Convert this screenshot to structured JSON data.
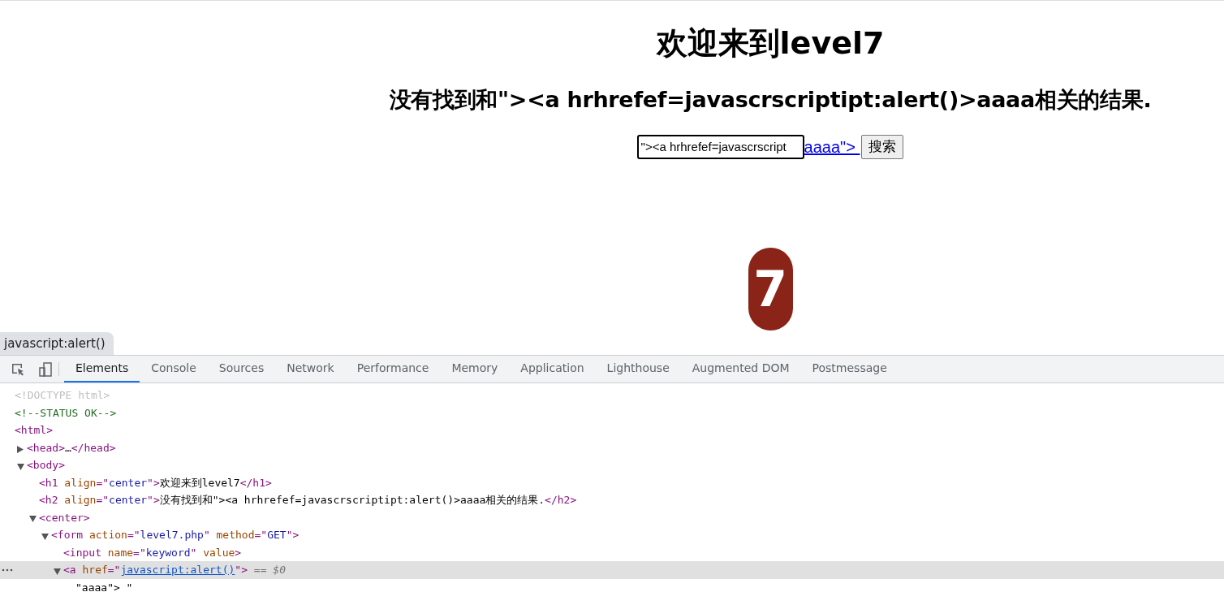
{
  "page": {
    "heading": "欢迎来到level7",
    "result": "没有找到和\"><a hrhrefef=javascrscriptipt:alert()>aaaa相关的结果.",
    "search": {
      "value": "\"><a hrhrefef=javascrscript",
      "focused": true
    },
    "link_text": "aaaa\">",
    "button": "搜索",
    "logo_text": "7"
  },
  "status_tooltip": "javascript:alert()",
  "devtools": {
    "tabs": [
      {
        "label": "Elements",
        "selected": true
      },
      {
        "label": "Console",
        "selected": false
      },
      {
        "label": "Sources",
        "selected": false
      },
      {
        "label": "Network",
        "selected": false
      },
      {
        "label": "Performance",
        "selected": false
      },
      {
        "label": "Memory",
        "selected": false
      },
      {
        "label": "Application",
        "selected": false
      },
      {
        "label": "Lighthouse",
        "selected": false
      },
      {
        "label": "Augmented DOM",
        "selected": false
      },
      {
        "label": "Postmessage",
        "selected": false
      }
    ],
    "tree": [
      {
        "tokens": [
          {
            "kind": "doctype",
            "text": "<!DOCTYPE html>"
          }
        ]
      },
      {
        "tokens": [
          {
            "kind": "comment",
            "text": "<!--STATUS OK-->"
          }
        ]
      },
      {
        "tokens": [
          {
            "kind": "tag",
            "text": "<html>"
          }
        ],
        "children": [
          {
            "expanded": false,
            "tokens": [
              {
                "kind": "tag",
                "text": "<head>"
              },
              {
                "kind": "text",
                "text": "…"
              },
              {
                "kind": "tag",
                "text": "</head>"
              }
            ]
          },
          {
            "expanded": true,
            "tokens": [
              {
                "kind": "tag",
                "text": "<body>"
              }
            ],
            "children": [
              {
                "tokens": [
                  {
                    "kind": "tag",
                    "text": "<h1 "
                  },
                  {
                    "kind": "attr",
                    "text": "align"
                  },
                  {
                    "kind": "tag",
                    "text": "=\""
                  },
                  {
                    "kind": "value",
                    "text": "center"
                  },
                  {
                    "kind": "tag",
                    "text": "\">"
                  },
                  {
                    "kind": "text",
                    "text": "欢迎来到level7"
                  },
                  {
                    "kind": "tag",
                    "text": "</h1>"
                  }
                ]
              },
              {
                "tokens": [
                  {
                    "kind": "tag",
                    "text": "<h2 "
                  },
                  {
                    "kind": "attr",
                    "text": "align"
                  },
                  {
                    "kind": "tag",
                    "text": "=\""
                  },
                  {
                    "kind": "value",
                    "text": "center"
                  },
                  {
                    "kind": "tag",
                    "text": "\">"
                  },
                  {
                    "kind": "text",
                    "text": "没有找到和\"><a hrhrefef=javascrscriptipt:alert()>aaaa相关的结果."
                  },
                  {
                    "kind": "tag",
                    "text": "</h2>"
                  }
                ]
              },
              {
                "expanded": true,
                "tokens": [
                  {
                    "kind": "tag",
                    "text": "<center>"
                  }
                ],
                "children": [
                  {
                    "expanded": true,
                    "tokens": [
                      {
                        "kind": "tag",
                        "text": "<form "
                      },
                      {
                        "kind": "attr",
                        "text": "action"
                      },
                      {
                        "kind": "tag",
                        "text": "=\""
                      },
                      {
                        "kind": "value",
                        "text": "level7.php"
                      },
                      {
                        "kind": "tag",
                        "text": "\" "
                      },
                      {
                        "kind": "attr",
                        "text": "method"
                      },
                      {
                        "kind": "tag",
                        "text": "=\""
                      },
                      {
                        "kind": "value",
                        "text": "GET"
                      },
                      {
                        "kind": "tag",
                        "text": "\">"
                      }
                    ],
                    "children": [
                      {
                        "tokens": [
                          {
                            "kind": "tag",
                            "text": "<input "
                          },
                          {
                            "kind": "attr",
                            "text": "name"
                          },
                          {
                            "kind": "tag",
                            "text": "=\""
                          },
                          {
                            "kind": "value",
                            "text": "keyword"
                          },
                          {
                            "kind": "tag",
                            "text": "\" "
                          },
                          {
                            "kind": "attr",
                            "text": "value"
                          },
                          {
                            "kind": "tag",
                            "text": ">"
                          }
                        ]
                      },
                      {
                        "expanded": true,
                        "selected": true,
                        "tokens": [
                          {
                            "kind": "tag",
                            "text": "<a "
                          },
                          {
                            "kind": "attr",
                            "text": "href"
                          },
                          {
                            "kind": "tag",
                            "text": "=\""
                          },
                          {
                            "kind": "link",
                            "text": "javascript:alert()"
                          },
                          {
                            "kind": "tag",
                            "text": "\">"
                          },
                          {
                            "kind": "ref",
                            "text": " == $0"
                          }
                        ],
                        "children": [
                          {
                            "tokens": [
                              {
                                "kind": "text",
                                "text": "\"aaaa\"> \""
                              }
                            ]
                          }
                        ]
                      }
                    ]
                  }
                ]
              }
            ]
          }
        ]
      }
    ]
  }
}
